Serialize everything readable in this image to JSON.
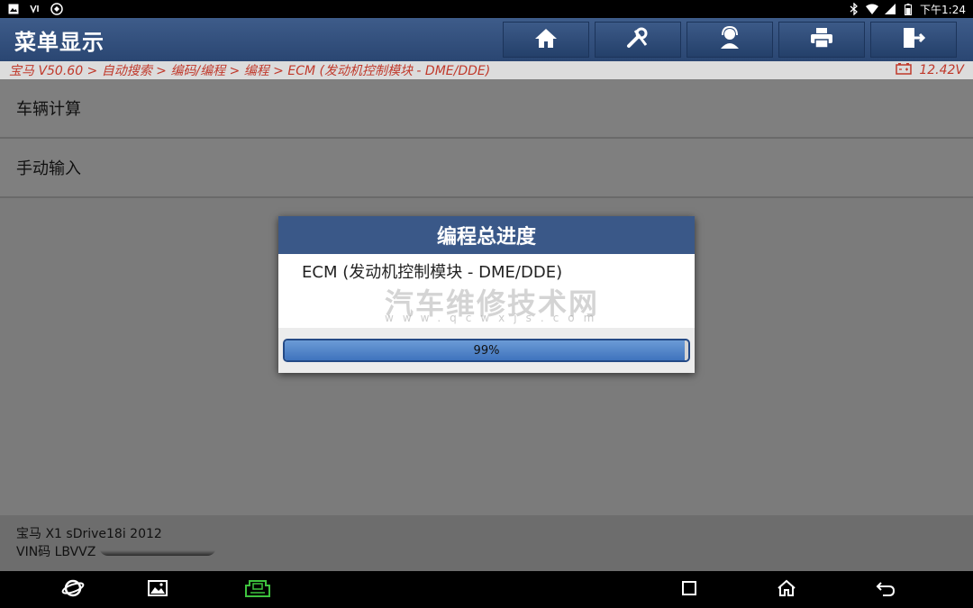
{
  "status_bar": {
    "time": "下午1:24",
    "left_icons": [
      "image-icon",
      "usb-icon",
      "vpn-icon"
    ],
    "right_icons": [
      "bluetooth-icon",
      "wifi-icon",
      "signal-icon",
      "battery-icon"
    ]
  },
  "header": {
    "title": "菜单显示",
    "toolbar": [
      "home-icon",
      "diagnostics-tool-icon",
      "support-person-icon",
      "printer-icon",
      "exit-icon"
    ]
  },
  "breadcrumb": {
    "path": "宝马 V50.60 > 自动搜索 > 编码/编程 > 编程 > ECM (发动机控制模块 - DME/DDE)",
    "voltage": "12.42V"
  },
  "menu": {
    "items": [
      {
        "label": "车辆计算"
      },
      {
        "label": "手动输入"
      }
    ]
  },
  "dialog": {
    "title": "编程总进度",
    "module": "ECM (发动机控制模块 - DME/DDE)",
    "watermark": "汽车维修技术网",
    "watermark_url": "www.qcwxjs.com",
    "progress_percent": 99,
    "progress_label": "99%"
  },
  "vehicle": {
    "model": "宝马 X1 sDrive18i 2012",
    "vin_prefix": "VIN码 LBVVZ"
  },
  "colors": {
    "header_blue": "#2f4d7c",
    "breadcrumb_red": "#c0392b",
    "progress_blue": "#4a7fc6",
    "vci_green": "#3ec33e"
  },
  "nav_bar": [
    "browser-icon",
    "gallery-icon",
    "vci-icon",
    "recent-apps-icon",
    "home-nav-icon",
    "back-icon"
  ]
}
